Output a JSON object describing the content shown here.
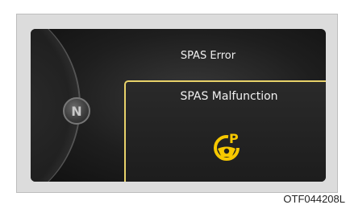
{
  "display": {
    "gear": "N",
    "header": "SPAS Error",
    "message": "SPAS Malfunction",
    "icon": "steering-wheel-parking-icon",
    "warning_color": "#f6c800",
    "border_color": "#e8d26a"
  },
  "caption": "OTF044208L"
}
